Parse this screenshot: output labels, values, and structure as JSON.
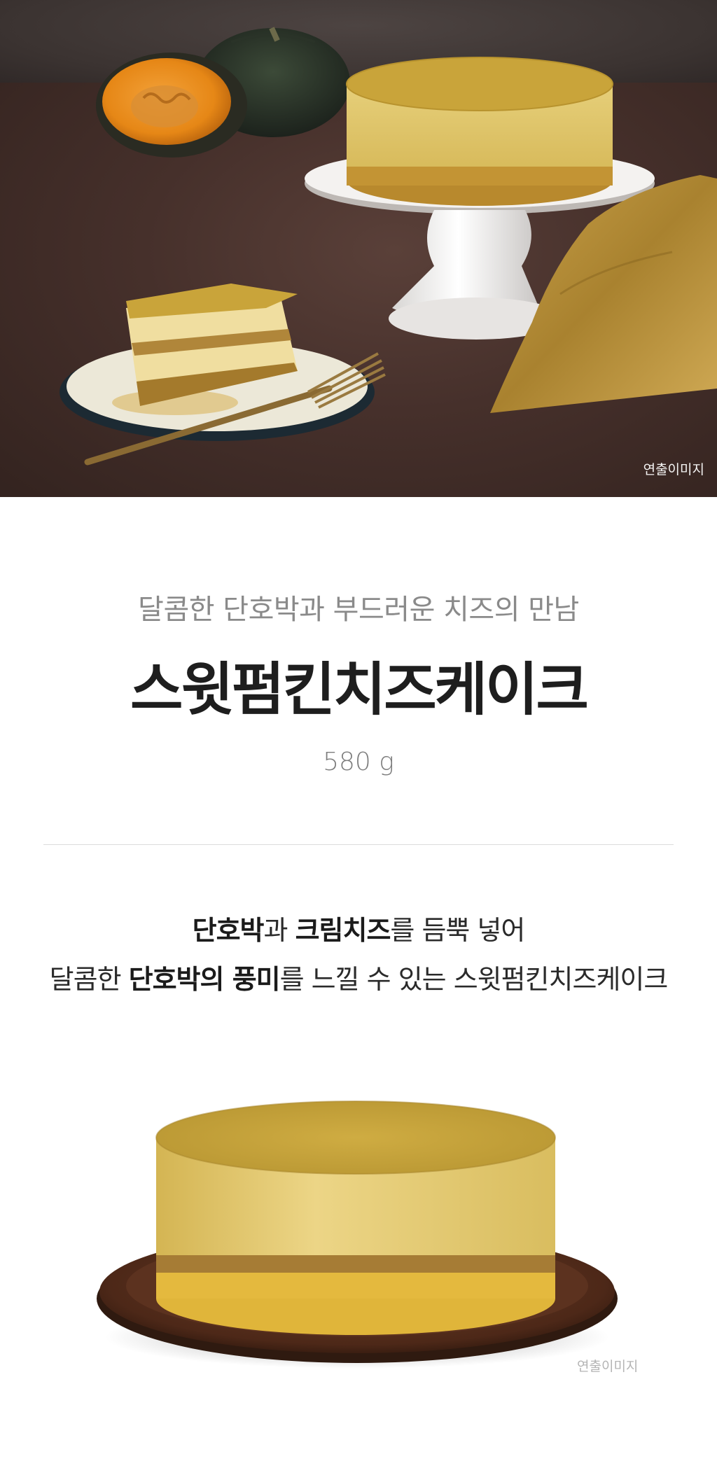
{
  "hero": {
    "alt": "스윗펌킨치즈케이크 연출 사진",
    "caption": "연출이미지"
  },
  "intro": {
    "subtitle": "달콤한 단호박과 부드러운 치즈의 만남",
    "title": "스윗펌킨치즈케이크",
    "weight": "580 g"
  },
  "description": {
    "line1": [
      {
        "text": "단호박",
        "bold": true
      },
      {
        "text": "과 ",
        "bold": false
      },
      {
        "text": "크림치즈",
        "bold": true
      },
      {
        "text": "를 듬뿍 넣어",
        "bold": false
      }
    ],
    "line2": [
      {
        "text": "달콤한 ",
        "bold": false
      },
      {
        "text": "단호박의 풍미",
        "bold": true
      },
      {
        "text": "를 느낄 수 있는 스윗펌킨치즈케이크",
        "bold": false
      }
    ]
  },
  "product_photo": {
    "caption": "연출이미지"
  },
  "colors": {
    "cake_top": "#c9a43a",
    "cake_body": "#e3c96b",
    "crust": "#a77a2e",
    "wood_plate": "#5a3322",
    "table": "#46302b"
  }
}
